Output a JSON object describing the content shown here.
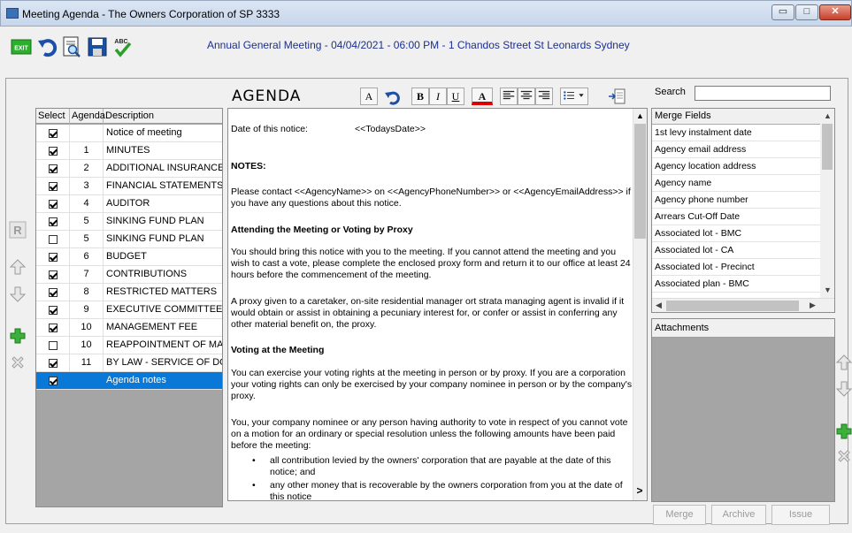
{
  "window": {
    "title": "Meeting Agenda - The Owners Corporation of SP 3333",
    "controls": {
      "minimize": "▭",
      "maximize": "□",
      "close": "✕"
    }
  },
  "toolbar": {
    "exit_label": "EXIT",
    "spell_label": "ABC",
    "meeting_title": "Annual General Meeting - 04/04/2021 - 06:00 PM - 1 Chandos Street St Leonards Sydney"
  },
  "side_buttons": {
    "r_label": "R"
  },
  "agenda_table": {
    "headers": {
      "select": "Select",
      "agenda": "Agenda",
      "description": "Description"
    },
    "rows": [
      {
        "checked": true,
        "agenda": "",
        "description": "Notice of meeting"
      },
      {
        "checked": true,
        "agenda": "1",
        "description": "MINUTES"
      },
      {
        "checked": true,
        "agenda": "2",
        "description": "ADDITIONAL INSURANCE"
      },
      {
        "checked": true,
        "agenda": "3",
        "description": "FINANCIAL STATEMENTS"
      },
      {
        "checked": true,
        "agenda": "4",
        "description": "AUDITOR"
      },
      {
        "checked": true,
        "agenda": "5",
        "description": "SINKING FUND PLAN"
      },
      {
        "checked": false,
        "agenda": "5",
        "description": "SINKING FUND PLAN"
      },
      {
        "checked": true,
        "agenda": "6",
        "description": "BUDGET"
      },
      {
        "checked": true,
        "agenda": "7",
        "description": "CONTRIBUTIONS"
      },
      {
        "checked": true,
        "agenda": "8",
        "description": "RESTRICTED MATTERS"
      },
      {
        "checked": true,
        "agenda": "9",
        "description": "EXECUTIVE COMMITTEE"
      },
      {
        "checked": true,
        "agenda": "10",
        "description": "MANAGEMENT FEE"
      },
      {
        "checked": false,
        "agenda": "10",
        "description": "REAPPOINTMENT OF MAI"
      },
      {
        "checked": true,
        "agenda": "11",
        "description": "BY LAW - SERVICE OF DO"
      },
      {
        "checked": true,
        "agenda": "",
        "description": "Agenda notes",
        "selected": true
      }
    ]
  },
  "editor": {
    "heading": "AGENDA",
    "format_buttons": {
      "a_plain": "A",
      "bold": "B",
      "italic": "I",
      "underline": "U",
      "a_color": "A"
    },
    "date_label": "Date of this notice:",
    "date_value": "<<TodaysDate>>",
    "notes_heading": "NOTES:",
    "p1": "Please contact <<AgencyName>> on <<AgencyPhoneNumber>> or <<AgencyEmailAddress>> if you have any questions about this notice.",
    "h_attending": "Attending the Meeting or Voting by Proxy",
    "p2": "You should bring this notice with you to the meeting. If you cannot attend the meeting and you wish to cast a vote, please complete the enclosed proxy form and return it to our office at least 24 hours before the commencement of the meeting.",
    "p3": "A proxy given to a caretaker, on-site residential manager ort strata managing agent is invalid if it would obtain or assist in obtaining a pecuniary interest for, or confer or assist in conferring any other material benefit on, the proxy.",
    "h_voting": "Voting at the Meeting",
    "p4": "You can exercise your voting rights at the meeting in person or by proxy. If you are a corporation your voting rights can only be exercised by your company nominee in person or by the company's proxy.",
    "p5": "You, your company nominee or any person having authority to vote in respect of you cannot vote on a motion for an ordinary or special resolution unless the following amounts have been paid before the meeting:",
    "bullet1": "all contribution levied by the owners' corporation that are payable at the date of this notice; and",
    "bullet2": "any other money that is recoverable by the owners corporation from you at the date of this notice",
    "more_label": ">"
  },
  "search": {
    "label": "Search",
    "value": "",
    "placeholder": ""
  },
  "merge_fields": {
    "header": "Merge Fields",
    "items": [
      "1st levy instalment date",
      "Agency email address",
      "Agency location address",
      "Agency name",
      "Agency phone number",
      "Arrears Cut-Off Date",
      "Associated lot - BMC",
      "Associated lot - CA",
      "Associated lot - Precinct",
      "Associated plan - BMC"
    ]
  },
  "attachments": {
    "header": "Attachments"
  },
  "bottom_buttons": {
    "merge": "Merge",
    "archive": "Archive",
    "issue": "Issue"
  },
  "colors": {
    "selection": "#0a78d7",
    "title_text": "#1c2f8f",
    "panel_gray": "#a5a5a5"
  }
}
